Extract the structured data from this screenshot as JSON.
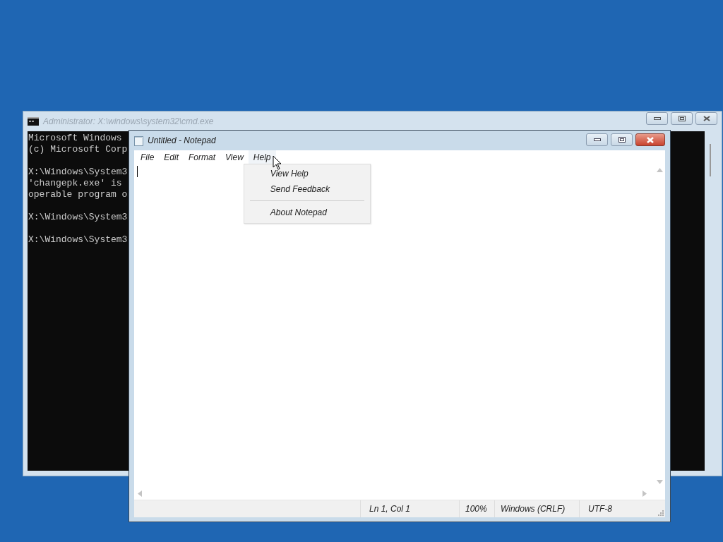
{
  "console_window": {
    "title": "Administrator: X:\\windows\\system32\\cmd.exe",
    "blocks": [
      [
        "Microsoft Windows",
        "(c) Microsoft Corp"
      ],
      [
        "X:\\Windows\\System3",
        "'changepk.exe' is",
        "operable program o"
      ],
      [
        "X:\\Windows\\System3"
      ],
      [
        "X:\\Windows\\System3"
      ]
    ]
  },
  "notepad_window": {
    "title": "Untitled - Notepad",
    "menus": [
      {
        "label": "File",
        "expanded": false
      },
      {
        "label": "Edit",
        "expanded": false
      },
      {
        "label": "Format",
        "expanded": false
      },
      {
        "label": "View",
        "expanded": false
      },
      {
        "label": "Help",
        "expanded": true,
        "items": [
          {
            "kind": "item",
            "label": "View Help"
          },
          {
            "kind": "item",
            "label": "Send Feedback"
          },
          {
            "kind": "separator"
          },
          {
            "kind": "item",
            "label": "About Notepad"
          }
        ]
      }
    ],
    "status_bar": [
      "Ln 1, Col 1",
      "100%",
      "Windows (CRLF)",
      "UTF-8"
    ]
  }
}
